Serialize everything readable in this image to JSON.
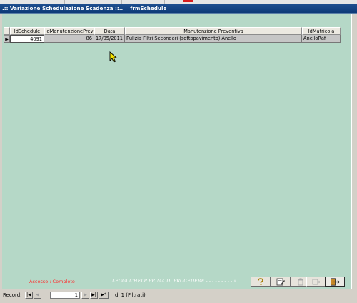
{
  "window": {
    "title": ".:: Variazione Schedulazione Scadenza ::..    frmSchedule"
  },
  "grid": {
    "columns": [
      "IdSchedule",
      "IdManutenzionePrev",
      "Data",
      "Manutenzione Preventiva",
      "IdMatricola"
    ],
    "row": {
      "selector_glyph": "▶",
      "IdSchedule": "4091",
      "IdManutenzionePrev": "86",
      "Data": "17/05/2011",
      "ManutenzionePreventiva": "Pulizia Filtri Secondari (sottopavimento) Anello",
      "IdMatricola": "AnelloRaf"
    }
  },
  "footer": {
    "access": "Accesso : Completo",
    "help": "LEGGI L'HELP PRIMA DI PROCEDERE  - - - - - - - - -  »",
    "buttons": [
      {
        "name": "help-icon",
        "enabled": true
      },
      {
        "name": "edit-icon",
        "enabled": true
      },
      {
        "name": "delete-icon",
        "enabled": false
      },
      {
        "name": "new-record-icon",
        "enabled": false
      },
      {
        "name": "exit-icon",
        "enabled": true
      }
    ]
  },
  "navigator": {
    "label": "Record:",
    "current": "1",
    "total_text": "di 1 (Filtrati)",
    "first": "|◀",
    "prev": "◀",
    "next": "▶",
    "last": "▶|",
    "new": "▶*"
  },
  "colors": {
    "form_background": "#b5d8c7",
    "title_bar": "#0d3a78",
    "access_text": "#ff2a2a"
  }
}
